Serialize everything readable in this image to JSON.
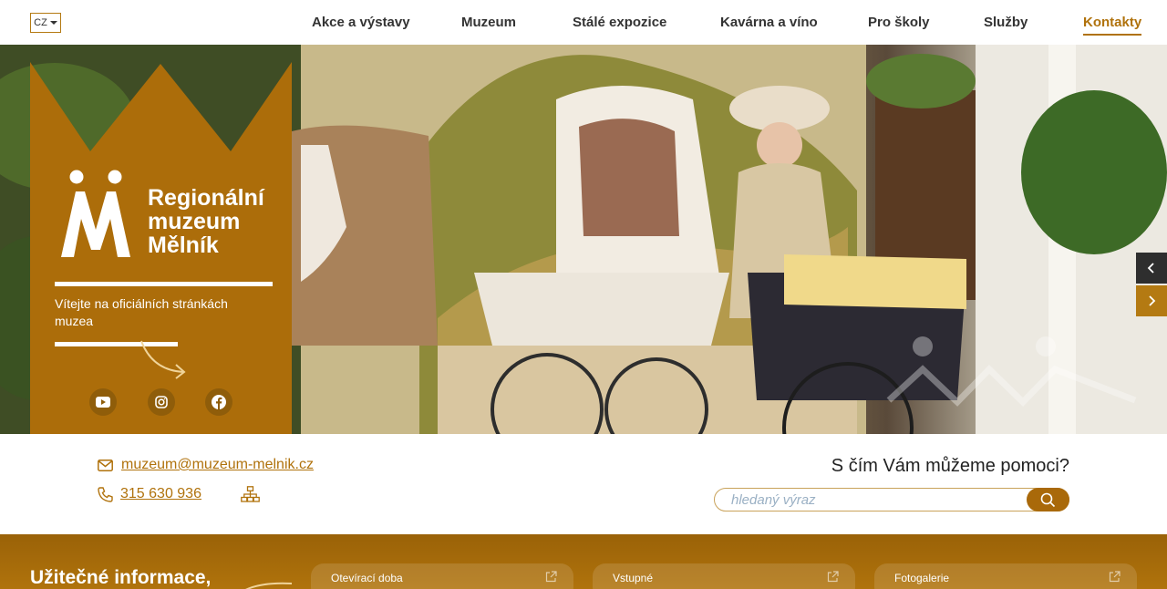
{
  "header": {
    "lang": "CZ",
    "nav": [
      {
        "label": "Akce a výstavy"
      },
      {
        "label": "Muzeum"
      },
      {
        "label": "Stálé expozice"
      },
      {
        "label": "Kavárna a víno"
      },
      {
        "label": "Pro školy"
      },
      {
        "label": "Služby"
      },
      {
        "label": "Kontakty",
        "active": true
      }
    ]
  },
  "hero": {
    "brand_lines": [
      "Regionální",
      "muzeum",
      "Mělník"
    ],
    "welcome": "Vítejte na oficiálních stránkách muzea",
    "socials": [
      "youtube-icon",
      "instagram-icon",
      "facebook-icon"
    ]
  },
  "contact": {
    "email": "muzeum@muzeum-melnik.cz",
    "phone": "315 630 936",
    "help_title": "S čím Vám  můžeme pomoci?",
    "search_placeholder": "hledaný výraz"
  },
  "info": {
    "title": "Užitečné informace,",
    "tiles": [
      {
        "label": "Otevírací doba"
      },
      {
        "label": "Vstupné"
      },
      {
        "label": "Fotogalerie"
      }
    ]
  },
  "colors": {
    "brand": "#b0720c",
    "brand_dark": "#8f5d0a"
  }
}
